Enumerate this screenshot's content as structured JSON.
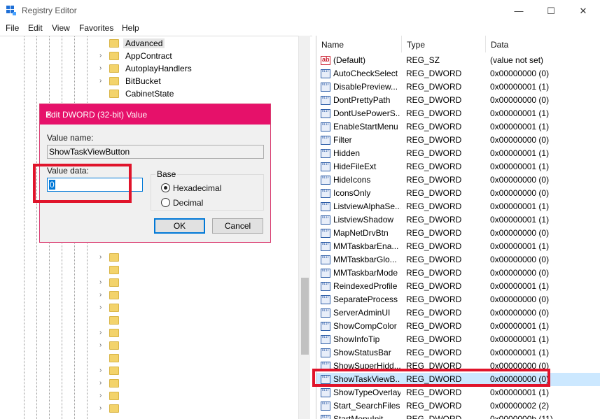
{
  "window": {
    "title": "Registry Editor",
    "minimize": "—",
    "maximize": "☐",
    "close": "✕"
  },
  "menu": [
    "File",
    "Edit",
    "View",
    "Favorites",
    "Help"
  ],
  "tree": {
    "items": [
      {
        "label": "Advanced",
        "selected": true
      },
      {
        "label": "AppContract"
      },
      {
        "label": "AutoplayHandlers"
      },
      {
        "label": "BitBucket"
      },
      {
        "label": "CabinetState"
      }
    ]
  },
  "list": {
    "headers": {
      "name": "Name",
      "type": "Type",
      "data": "Data"
    },
    "rows": [
      {
        "name": "(Default)",
        "type": "REG_SZ",
        "data": "(value not set)",
        "icon": "ab"
      },
      {
        "name": "AutoCheckSelect",
        "type": "REG_DWORD",
        "data": "0x00000000 (0)",
        "icon": "bin"
      },
      {
        "name": "DisablePreview...",
        "type": "REG_DWORD",
        "data": "0x00000001 (1)",
        "icon": "bin"
      },
      {
        "name": "DontPrettyPath",
        "type": "REG_DWORD",
        "data": "0x00000000 (0)",
        "icon": "bin"
      },
      {
        "name": "DontUsePowerS...",
        "type": "REG_DWORD",
        "data": "0x00000001 (1)",
        "icon": "bin"
      },
      {
        "name": "EnableStartMenu",
        "type": "REG_DWORD",
        "data": "0x00000001 (1)",
        "icon": "bin"
      },
      {
        "name": "Filter",
        "type": "REG_DWORD",
        "data": "0x00000000 (0)",
        "icon": "bin"
      },
      {
        "name": "Hidden",
        "type": "REG_DWORD",
        "data": "0x00000001 (1)",
        "icon": "bin"
      },
      {
        "name": "HideFileExt",
        "type": "REG_DWORD",
        "data": "0x00000001 (1)",
        "icon": "bin"
      },
      {
        "name": "HideIcons",
        "type": "REG_DWORD",
        "data": "0x00000000 (0)",
        "icon": "bin"
      },
      {
        "name": "IconsOnly",
        "type": "REG_DWORD",
        "data": "0x00000000 (0)",
        "icon": "bin"
      },
      {
        "name": "ListviewAlphaSe...",
        "type": "REG_DWORD",
        "data": "0x00000001 (1)",
        "icon": "bin"
      },
      {
        "name": "ListviewShadow",
        "type": "REG_DWORD",
        "data": "0x00000001 (1)",
        "icon": "bin"
      },
      {
        "name": "MapNetDrvBtn",
        "type": "REG_DWORD",
        "data": "0x00000000 (0)",
        "icon": "bin"
      },
      {
        "name": "MMTaskbarEna...",
        "type": "REG_DWORD",
        "data": "0x00000001 (1)",
        "icon": "bin"
      },
      {
        "name": "MMTaskbarGlo...",
        "type": "REG_DWORD",
        "data": "0x00000000 (0)",
        "icon": "bin"
      },
      {
        "name": "MMTaskbarMode",
        "type": "REG_DWORD",
        "data": "0x00000000 (0)",
        "icon": "bin"
      },
      {
        "name": "ReindexedProfile",
        "type": "REG_DWORD",
        "data": "0x00000001 (1)",
        "icon": "bin"
      },
      {
        "name": "SeparateProcess",
        "type": "REG_DWORD",
        "data": "0x00000000 (0)",
        "icon": "bin"
      },
      {
        "name": "ServerAdminUI",
        "type": "REG_DWORD",
        "data": "0x00000000 (0)",
        "icon": "bin"
      },
      {
        "name": "ShowCompColor",
        "type": "REG_DWORD",
        "data": "0x00000001 (1)",
        "icon": "bin"
      },
      {
        "name": "ShowInfoTip",
        "type": "REG_DWORD",
        "data": "0x00000001 (1)",
        "icon": "bin"
      },
      {
        "name": "ShowStatusBar",
        "type": "REG_DWORD",
        "data": "0x00000001 (1)",
        "icon": "bin"
      },
      {
        "name": "ShowSuperHidd...",
        "type": "REG_DWORD",
        "data": "0x00000000 (0)",
        "icon": "bin"
      },
      {
        "name": "ShowTaskViewB...",
        "type": "REG_DWORD",
        "data": "0x00000000 (0)",
        "icon": "bin",
        "selected": true
      },
      {
        "name": "ShowTypeOverlay",
        "type": "REG_DWORD",
        "data": "0x00000001 (1)",
        "icon": "bin"
      },
      {
        "name": "Start_SearchFiles",
        "type": "REG_DWORD",
        "data": "0x00000002 (2)",
        "icon": "bin"
      },
      {
        "name": "StartMenuInit",
        "type": "REG_DWORD",
        "data": "0x0000000b (11)",
        "icon": "bin"
      }
    ]
  },
  "dialog": {
    "title": "Edit DWORD (32-bit) Value",
    "close": "✕",
    "value_name_label": "Value name:",
    "value_name": "ShowTaskViewButton",
    "value_data_label": "Value data:",
    "value_data": "0",
    "base_label": "Base",
    "hex_label": "Hexadecimal",
    "dec_label": "Decimal",
    "base_selected": "Hexadecimal",
    "ok": "OK",
    "cancel": "Cancel"
  },
  "colors": {
    "dialog_title_bg": "#e6116a",
    "highlight": "#e0142b",
    "selection": "#cce8ff"
  }
}
